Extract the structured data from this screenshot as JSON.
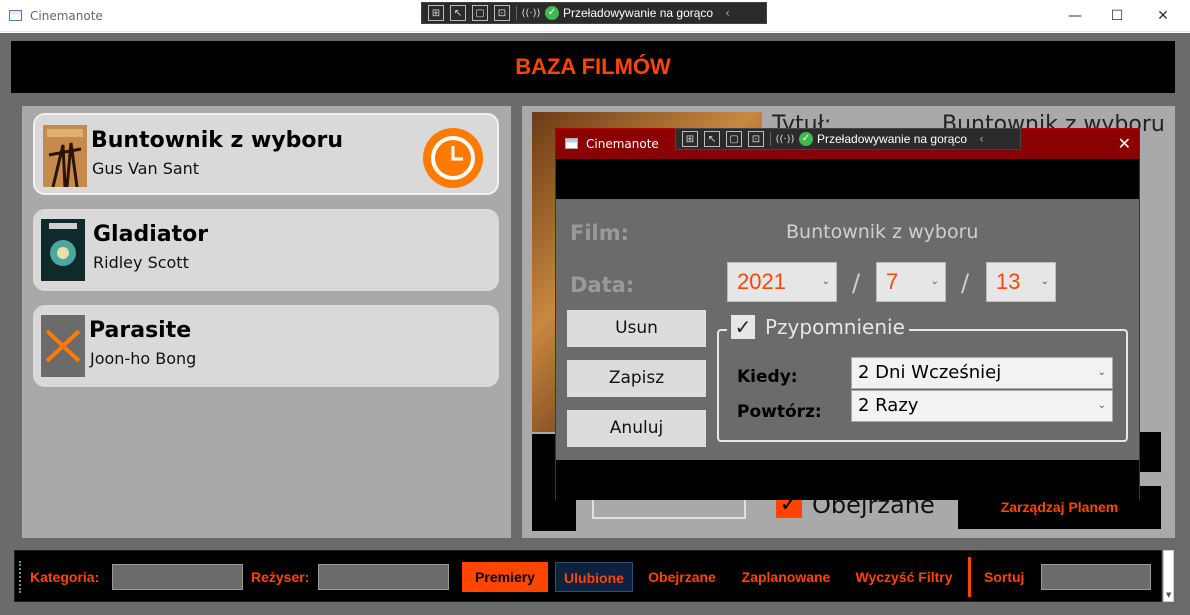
{
  "window": {
    "title": "Cinemanote",
    "minimize": "—",
    "maximize": "☐",
    "close": "✕"
  },
  "devbar": {
    "hot_reload": "Przeładowywanie na gorąco",
    "check": "✓",
    "chevron": "‹",
    "tool_icons": [
      "select-element-icon",
      "pointer-icon",
      "layout-adorner-icon",
      "track-focus-icon",
      "accessibility-icon"
    ]
  },
  "header": {
    "title": "BAZA FILMÓW"
  },
  "movies": [
    {
      "title": "Buntownik z wyboru",
      "director": "Gus Van Sant",
      "selected": true,
      "poster_icon": "poster-image",
      "status_icon": "clock-icon"
    },
    {
      "title": "Gladiator",
      "director": "Ridley Scott",
      "selected": false,
      "poster_icon": "poster-image"
    },
    {
      "title": "Parasite",
      "director": "Joon-ho Bong",
      "selected": false,
      "poster_icon": "no-poster-x-icon"
    }
  ],
  "detail": {
    "title_label": "Tytuł:",
    "title_value": "Buntownik z wyboru",
    "watched_label": "Obejrzane",
    "watched_checked": true,
    "manage_plan": "Zarządzaj Planem"
  },
  "filterbar": {
    "category_label": "Kategoria:",
    "director_label": "Reżyser:",
    "premiery": "Premiery",
    "ulubione": "Ulubione",
    "obejrzane": "Obejrzane",
    "zaplanowane": "Zaplanowane",
    "clear": "Wyczyść Filtry",
    "sort_label": "Sortuj"
  },
  "dialog": {
    "title": "Cinemanote",
    "film_label": "Film:",
    "film_value": "Buntownik z wyboru",
    "date_label": "Data:",
    "year": "2021",
    "month": "7",
    "day": "13",
    "separator": "/",
    "delete": "Usun",
    "save": "Zapisz",
    "cancel": "Anuluj",
    "reminder_label": "Pzypomnienie",
    "reminder_checked": true,
    "when_label": "Kiedy:",
    "when_value": "2 Dni Wcześniej",
    "repeat_label": "Powtórz:",
    "repeat_value": "2 Razy"
  },
  "colors": {
    "accent": "#ff4500",
    "panel": "#a9a9a9",
    "background": "#6b6b6b",
    "clock": "#ff7a00"
  }
}
